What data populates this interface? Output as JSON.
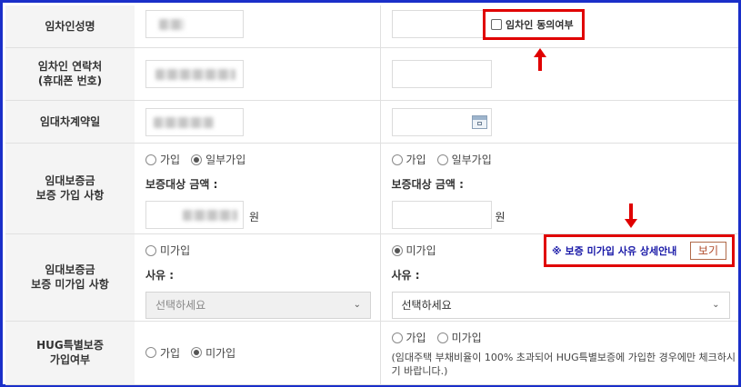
{
  "rows": {
    "tenant_name": {
      "label": "임차인성명",
      "consent_label": "임차인 동의여부"
    },
    "tenant_contact": {
      "label_line1": "임차인 연락처",
      "label_line2": "(휴대폰 번호)"
    },
    "contract_date": {
      "label": "임대차계약일"
    },
    "deposit_join": {
      "label_line1": "임대보증금",
      "label_line2": "보증 가입 사항",
      "option_join": "가입",
      "option_partial": "일부가입",
      "amount_label": "보증대상 금액 :",
      "won": "원",
      "left_selected": "일부가입",
      "right_selected": ""
    },
    "deposit_nonjoin": {
      "label_line1": "임대보증금",
      "label_line2": "보증 미가입 사항",
      "option_nonjoin": "미가입",
      "reason_label": "사유 :",
      "select_placeholder": "선택하세요",
      "guide_text": "※ 보증 미가입 사유 상세안내",
      "view_button": "보기",
      "right_selected": "미가입"
    },
    "hug": {
      "label_line1": "HUG특별보증",
      "label_line2": "가입여부",
      "option_join": "가입",
      "option_nonjoin": "미가입",
      "left_selected": "미가입",
      "note": "(임대주택 부채비율이 100% 초과되어 HUG특별보증에 가입한 경우에만 체크하시기 바랍니다.)"
    }
  },
  "colors": {
    "frame": "#1a2fc9",
    "highlight": "#e00000",
    "guide_text": "#1a1aa8"
  }
}
